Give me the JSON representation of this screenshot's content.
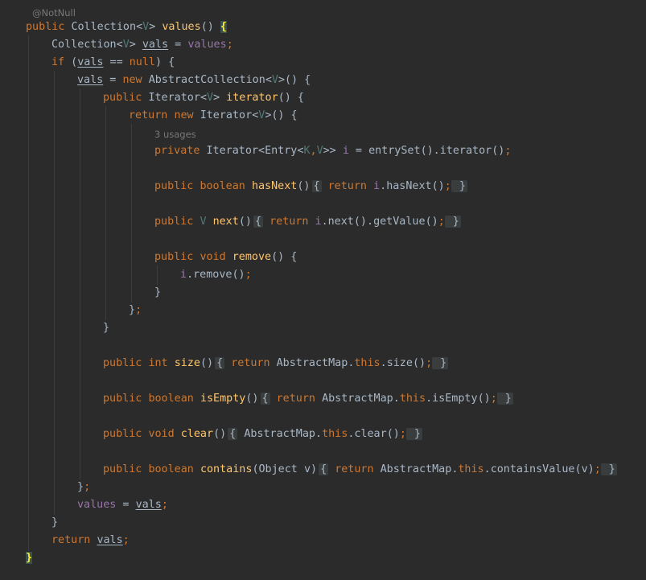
{
  "editor": {
    "annotation": "@NotNull",
    "usages_hint": "3 usages",
    "tokens": {
      "public": "public",
      "private": "private",
      "return": "return",
      "new": "new",
      "if": "if",
      "null": "null",
      "boolean": "boolean",
      "void": "void",
      "int": "int",
      "this": "this"
    },
    "types": {
      "collection": "Collection",
      "v": "V",
      "k": "K",
      "abstract_collection": "AbstractCollection",
      "iterator": "Iterator",
      "entry": "Entry",
      "abstract_map": "AbstractMap",
      "object": "Object"
    },
    "names": {
      "values": "values",
      "vals": "vals",
      "iterator": "iterator",
      "hasNext": "hasNext",
      "next": "next",
      "remove": "remove",
      "size": "size",
      "isEmpty": "isEmpty",
      "clear": "clear",
      "contains": "contains",
      "entrySet": "entrySet",
      "getValue": "getValue",
      "containsValue": "containsValue",
      "i": "i",
      "v": "v"
    }
  }
}
